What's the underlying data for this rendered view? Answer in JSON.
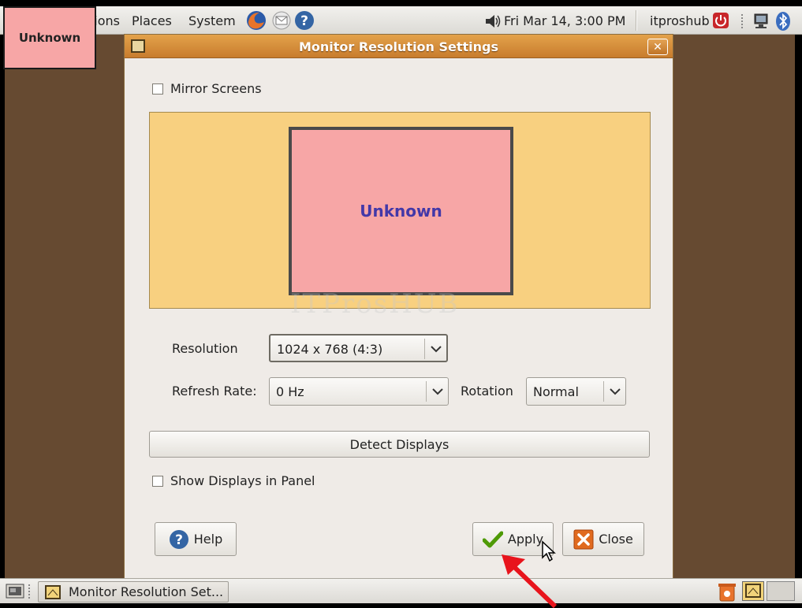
{
  "top_panel": {
    "menus": [
      "Applications",
      "Places",
      "System"
    ],
    "clock": "Fri Mar 14,  3:00 PM",
    "user": "itproshub"
  },
  "corner_label": "Unknown",
  "dialog": {
    "title": "Monitor Resolution Settings",
    "close_glyph": "✕",
    "mirror_label": "Mirror Screens",
    "monitor_name": "Unknown",
    "watermark": "ITProsHUB",
    "resolution_label": "Resolution",
    "resolution_value": "1024 x 768 (4:3)",
    "refresh_label": "Refresh Rate:",
    "refresh_value": "0 Hz",
    "rotation_label": "Rotation",
    "rotation_value": "Normal",
    "detect_button": "Detect Displays",
    "show_panel_label": "Show Displays in Panel",
    "help_button": "Help",
    "apply_button": "Apply",
    "close_button": "Close"
  },
  "taskbar": {
    "window_item": "Monitor Resolution Set..."
  },
  "colors": {
    "titlebar": "#d88b3a",
    "monitor_area": "#f8d080",
    "monitor_box": "#f7a6a6",
    "desktop": "#664a31"
  }
}
